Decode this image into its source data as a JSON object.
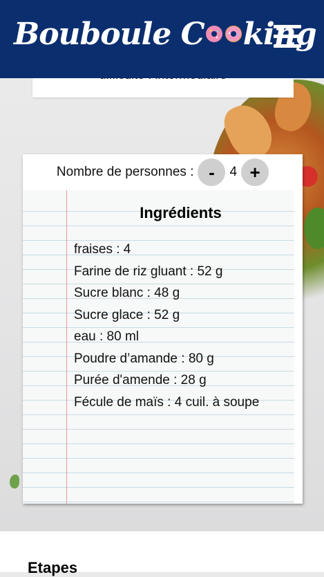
{
  "header": {
    "logo_text_before": "Bouboule C",
    "logo_text_after": "king",
    "background_color": "#0b2e6f",
    "menu_icon": "hamburger-menu-icon"
  },
  "top_card": {
    "difficulty": "difficulté : intermédiaire"
  },
  "servings": {
    "label": "Nombre de personnes :",
    "minus": "-",
    "count": "4",
    "plus": "+"
  },
  "ingredients": {
    "title": "Ingrédients",
    "items": [
      "fraises : 4",
      "Farine de riz gluant : 52 g",
      "Sucre blanc : 48 g",
      "Sucre glace : 52 g",
      "eau : 80 ml",
      "Poudre d’amande : 80 g",
      "Purée d'amende : 28 g",
      "Fécule de maïs : 4 cuil. à soupe"
    ]
  },
  "steps": {
    "title": "Etapes"
  }
}
